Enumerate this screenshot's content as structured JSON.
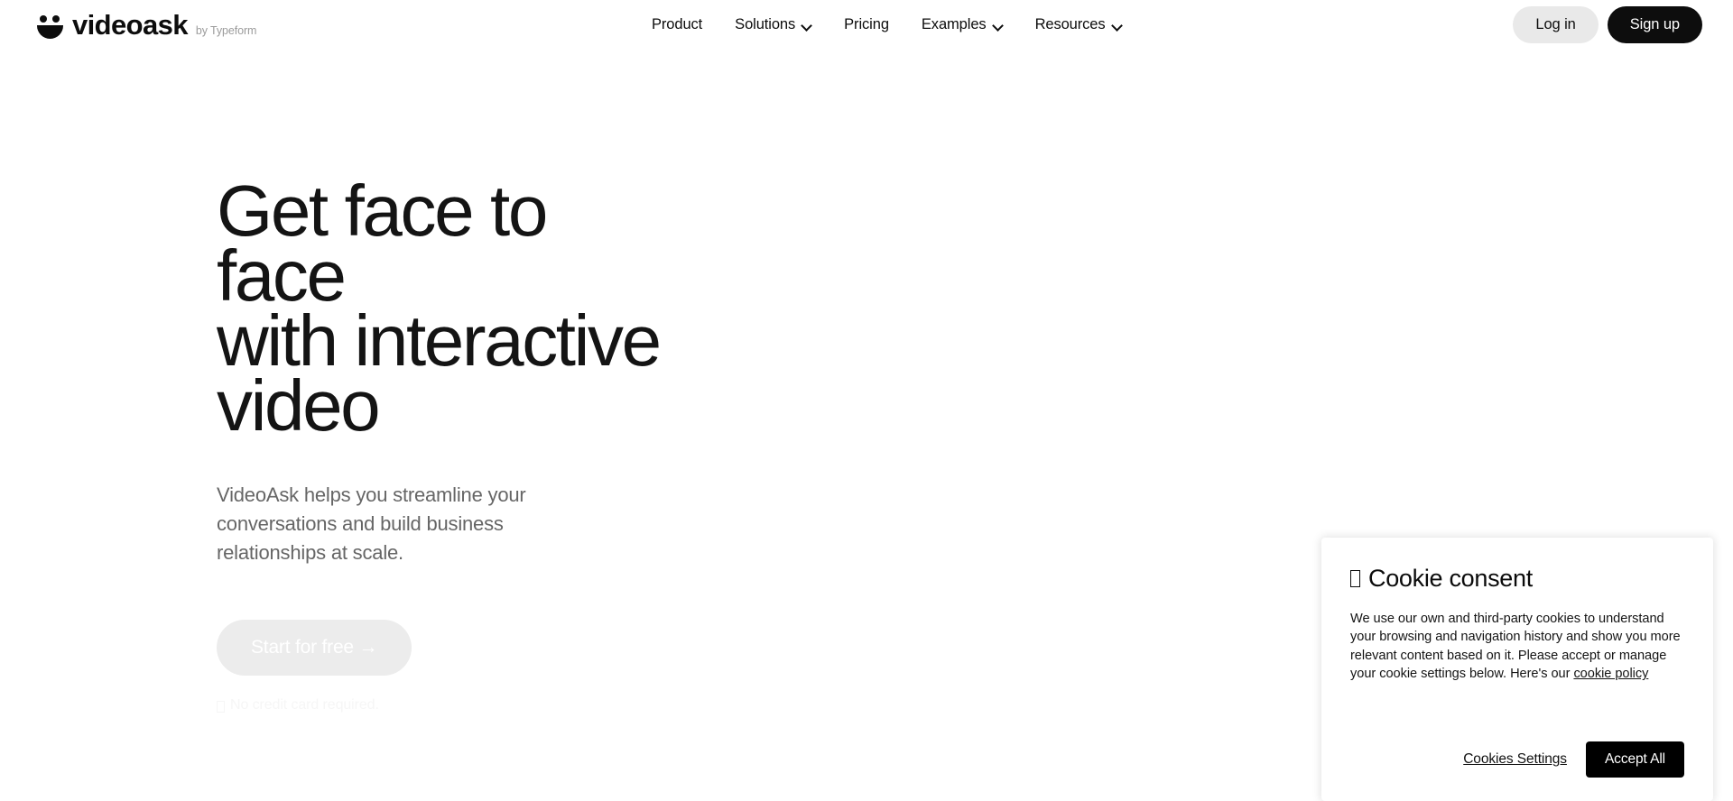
{
  "header": {
    "brand": {
      "logo_icon": "videoask-smiley-icon",
      "name": "videoask",
      "byline": "by Typeform"
    },
    "nav": [
      {
        "label": "Product",
        "has_dropdown": false
      },
      {
        "label": "Solutions",
        "has_dropdown": true
      },
      {
        "label": "Pricing",
        "has_dropdown": false
      },
      {
        "label": "Examples",
        "has_dropdown": true
      },
      {
        "label": "Resources",
        "has_dropdown": true
      }
    ],
    "auth": {
      "login_label": "Log in",
      "signup_label": "Sign up"
    }
  },
  "hero": {
    "title": "Get face to face\nwith interactive\nvideo",
    "subtitle": "VideoAsk helps you streamline your conversations and build business relationships at scale.",
    "cta_label": "Start for free →",
    "cta_note": "No credit card required."
  },
  "cookie_consent": {
    "title": "Cookie consent",
    "body_before_link": "We use our own and third-party cookies to understand your browsing and navigation history and show you more relevant content based on it. Please accept or manage your cookie settings below. Here's our ",
    "policy_link_label": "cookie policy",
    "settings_label": "Cookies Settings",
    "accept_label": "Accept All"
  },
  "colors": {
    "page_background": "#ffffff",
    "text_primary": "#0d0d0d",
    "text_muted": "#666666",
    "accent_dark": "#000000",
    "login_pill": "#e9e9e9",
    "cta_disabled": "#ececec"
  }
}
